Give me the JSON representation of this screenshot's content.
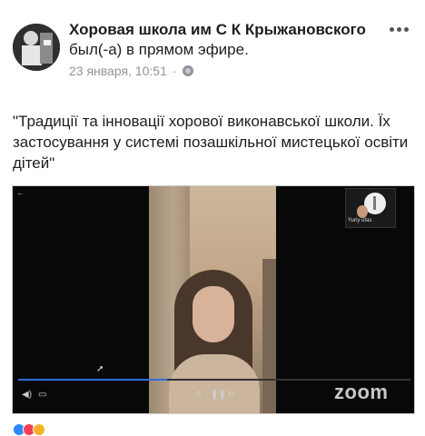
{
  "post": {
    "page_name": "Хоровая школа им С К Крыжановского",
    "action_text": "был(-а) в прямом эфире.",
    "timestamp": "23 января, 10:51",
    "separator": "·",
    "text": "\"Традиції та інновації хорової виконавської школи. Їх застосування у системі позашкільної мистецької освіти дітей\""
  },
  "video": {
    "participant_label": "Yuriy ufas",
    "progress_fraction": 0.38,
    "brand": "zoom"
  },
  "colors": {
    "accent": "#2d6de0",
    "meta_text": "#90949c",
    "reaction_like": "#2d88ff",
    "reaction_love": "#f33e58",
    "reaction_haha": "#f7b125"
  }
}
